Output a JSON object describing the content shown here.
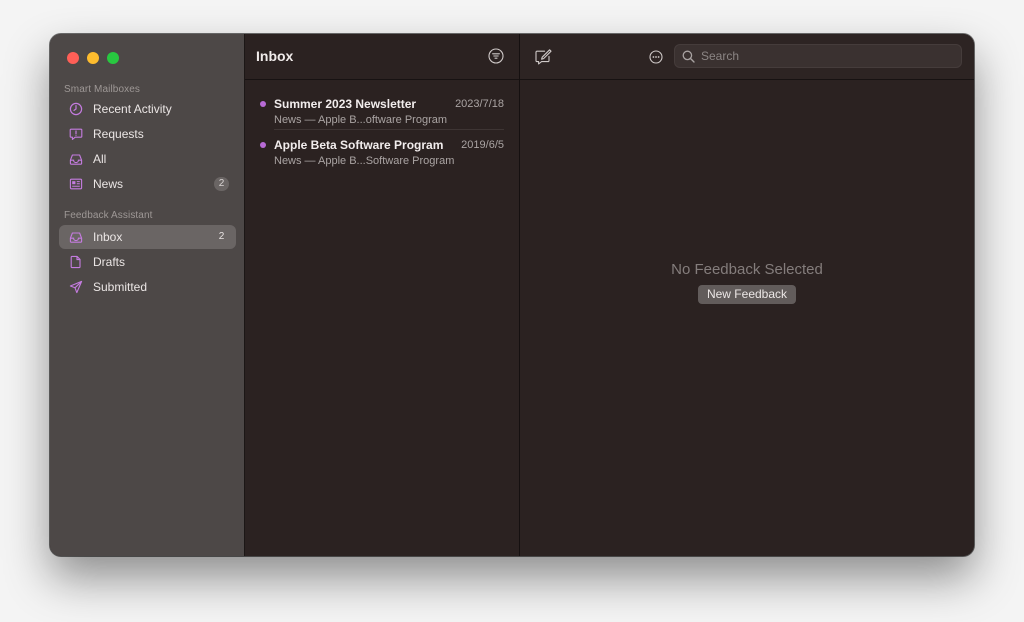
{
  "window": {
    "accent": "#b86bd6"
  },
  "sidebar": {
    "smart_title": "Smart Mailboxes",
    "smart_items": [
      {
        "label": "Recent Activity",
        "icon": "clock-icon"
      },
      {
        "label": "Requests",
        "icon": "speech-bubble-icon"
      },
      {
        "label": "All",
        "icon": "tray-icon"
      },
      {
        "label": "News",
        "icon": "newspaper-icon",
        "badge": "2"
      }
    ],
    "fa_title": "Feedback Assistant",
    "fa_items": [
      {
        "label": "Inbox",
        "icon": "tray-icon",
        "badge": "2",
        "selected": true
      },
      {
        "label": "Drafts",
        "icon": "document-icon"
      },
      {
        "label": "Submitted",
        "icon": "paper-plane-icon"
      }
    ]
  },
  "list": {
    "title": "Inbox",
    "messages": [
      {
        "subject": "Summer 2023 Newsletter",
        "date": "2023/7/18",
        "preview": "News — Apple B...oftware Program",
        "unread": true
      },
      {
        "subject": "Apple Beta Software Program",
        "date": "2019/6/5",
        "preview": "News — Apple B...Software Program",
        "unread": true
      }
    ]
  },
  "detail": {
    "search_placeholder": "Search",
    "empty_title": "No Feedback Selected",
    "new_feedback_label": "New Feedback"
  }
}
